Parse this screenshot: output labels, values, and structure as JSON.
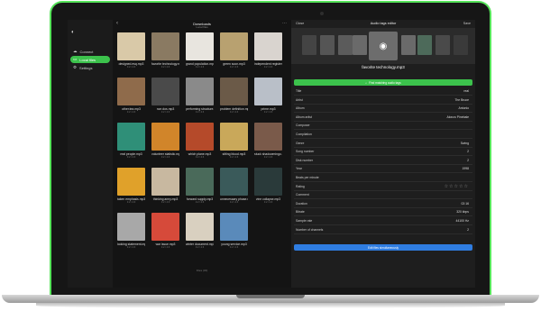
{
  "sidebar": {
    "items": [
      {
        "label": "Connect",
        "icon": "cloud-icon"
      },
      {
        "label": "Local files",
        "icon": "folder-icon"
      },
      {
        "label": "Settings",
        "icon": "gear-icon"
      }
    ]
  },
  "browser": {
    "title": "Downloads",
    "subtitle": "Local files",
    "files_count": "Files (30)",
    "tiles": [
      {
        "name": "designed.esq.mp3",
        "meta": "3.2 / 4.6",
        "color": "#d9c9a8"
      },
      {
        "name": "favorite technology.mp3",
        "meta": "3.2 / 4.6",
        "color": "#8a7a62"
      },
      {
        "name": "grand population.mp3",
        "meta": "3.2 / 4.6",
        "color": "#e8e5df"
      },
      {
        "name": "green soon.mp3",
        "meta": "3.2 / 4.6",
        "color": "#b8a170"
      },
      {
        "name": "independent register.mp3",
        "meta": "3.2 / 4.6",
        "color": "#d9d4cf"
      },
      {
        "name": "other.tea.mp3",
        "meta": "3.2 / 4.6",
        "color": "#8f6b4b"
      },
      {
        "name": "non dos.mp3",
        "meta": "3.2 / 4.6",
        "color": "#4a4a4a"
      },
      {
        "name": "performing structure.mp3",
        "meta": "3.2 / 4.6",
        "color": "#8a8a8a"
      },
      {
        "name": "problem definition.mp3",
        "meta": "3.2 / 4.6",
        "color": "#6b5a48"
      },
      {
        "name": "prime.mp3",
        "meta": "3.2 / 4.6",
        "color": "#b9bfc8"
      },
      {
        "name": "real people.mp3",
        "meta": "3.2 / 4.6",
        "color": "#2f8f78"
      },
      {
        "name": "volunteer statistic.mp3",
        "meta": "3.2 / 4.6",
        "color": "#d1852a"
      },
      {
        "name": "which plane.mp3",
        "meta": "3.2 / 4.6",
        "color": "#b54a2a"
      },
      {
        "name": "sitting blood.mp3",
        "meta": "3.2 / 4.6",
        "color": "#c9a85a"
      },
      {
        "name": "stuck shadowmingo.mp3",
        "meta": "3.2 / 4.6",
        "color": "#7a5a4a"
      },
      {
        "name": "taken emphasis.mp3",
        "meta": "3.2 / 4.6",
        "color": "#e0a12a"
      },
      {
        "name": "thinking army.mp3",
        "meta": "3.2 / 4.6",
        "color": "#c8b8a0"
      },
      {
        "name": "forward supply.mp3",
        "meta": "3.2 / 4.6",
        "color": "#4a6a5a"
      },
      {
        "name": "unnecessary phase.mp3",
        "meta": "3.2 / 4.6",
        "color": "#3a5a5a"
      },
      {
        "name": "vine collapse.mp3",
        "meta": "3.2 / 4.6",
        "color": "#2a3a3a"
      },
      {
        "name": "looking statement.mp3",
        "meta": "3.2 / 4.6",
        "color": "#a8a8a8"
      },
      {
        "name": "war issue.mp3",
        "meta": "3.2 / 4.6",
        "color": "#d64a3a"
      },
      {
        "name": "winter document.mp3",
        "meta": "3.2 / 4.6",
        "color": "#d9d0c0"
      },
      {
        "name": "young service.mp3",
        "meta": "3.2 / 4.6",
        "color": "#5a8aba"
      }
    ]
  },
  "editor": {
    "close_label": "Close",
    "title": "Audio tags editor",
    "save_label": "Save",
    "file_name": "favorite technology.mp3",
    "find_button": "Find matching audio tags",
    "fields": [
      {
        "label": "Title",
        "value": "real"
      },
      {
        "label": "Artist",
        "value": "The Bruce"
      },
      {
        "label": "Album",
        "value": "Antonio"
      },
      {
        "label": "Album artist",
        "value": "Alonzo Pinebale"
      },
      {
        "label": "Composer",
        "value": ""
      },
      {
        "label": "Compilation",
        "value": ""
      },
      {
        "label": "Genre",
        "value": "Swing"
      },
      {
        "label": "Song number",
        "value": "2"
      },
      {
        "label": "Disk number",
        "value": "2"
      },
      {
        "label": "Year",
        "value": "1998"
      },
      {
        "label": "Beats per minute",
        "value": ""
      },
      {
        "label": "Rating",
        "value": ""
      },
      {
        "label": "Comment",
        "value": ""
      },
      {
        "label": "Duration",
        "value": "02:16"
      },
      {
        "label": "Bitrate",
        "value": "320 kbps"
      },
      {
        "label": "Sample rate",
        "value": "44100 Hz"
      },
      {
        "label": "Number of channels",
        "value": "2"
      }
    ],
    "rating_stars": "☆☆☆☆☆",
    "edit_button": "Edit files simultaneously"
  }
}
